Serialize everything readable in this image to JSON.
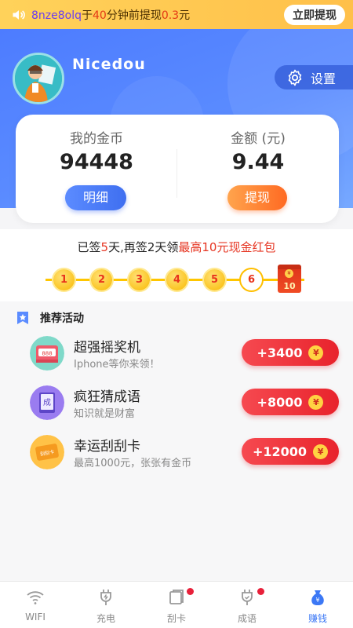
{
  "ticker": {
    "user": "8nze8olq",
    "at": "于",
    "minutes": "40",
    "text_mid": "分钟前提现",
    "amount": "0.3",
    "unit": "元",
    "action": "立即提现"
  },
  "profile": {
    "username": "Nicedou",
    "settings_label": "设置"
  },
  "balance": {
    "coins_label": "我的金币",
    "coins_value": "94448",
    "detail_button": "明细",
    "amount_label": "金额 (元)",
    "amount_value": "9.44",
    "withdraw_button": "提现"
  },
  "signin": {
    "text_a": "已签",
    "days_signed": "5",
    "text_b": "天,再签2天领",
    "highlight": "最高10元现金红包",
    "days": [
      "1",
      "2",
      "3",
      "4",
      "5",
      "6"
    ],
    "reward_day": "10"
  },
  "activities": {
    "header": "推荐活动",
    "items": [
      {
        "title": "超强摇奖机",
        "subtitle": "Iphone等你来领！",
        "reward": "+3400",
        "icon": "slot-machine-icon"
      },
      {
        "title": "疯狂猜成语",
        "subtitle": "知识就是财富",
        "reward": "+8000",
        "icon": "idiom-book-icon"
      },
      {
        "title": "幸运刮刮卡",
        "subtitle": "最高1000元，张张有金币",
        "reward": "+12000",
        "icon": "scratch-card-icon"
      }
    ]
  },
  "tabs": [
    {
      "label": "WIFI",
      "icon": "wifi-icon",
      "active": false,
      "dot": false
    },
    {
      "label": "充电",
      "icon": "charger-icon",
      "active": false,
      "dot": false
    },
    {
      "label": "刮卡",
      "icon": "card-icon",
      "active": false,
      "dot": true
    },
    {
      "label": "成语",
      "icon": "idiom-icon",
      "active": false,
      "dot": true
    },
    {
      "label": "赚钱",
      "icon": "money-bag-icon",
      "active": true,
      "dot": false
    }
  ],
  "colors": {
    "primary_blue": "#4d7cff",
    "ticker_yellow": "#ffc04a",
    "reward_red": "#e8232c",
    "accent_orange": "#ff6a22"
  }
}
